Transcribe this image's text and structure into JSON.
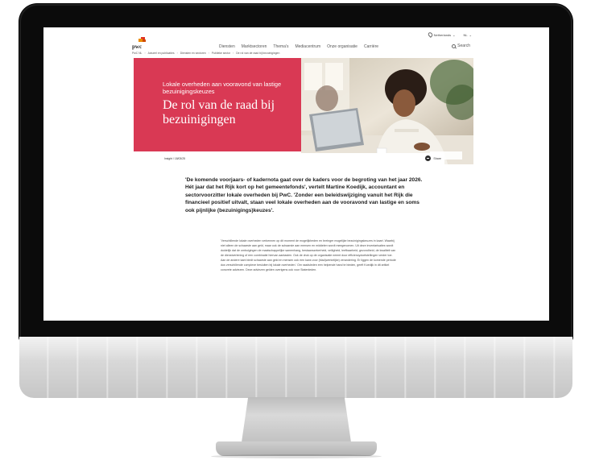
{
  "utility": {
    "country": "Netherlands",
    "language": "NL"
  },
  "brand": {
    "logo_text": "pwc"
  },
  "nav": {
    "items": [
      "Diensten",
      "Marktsectoren",
      "Thema's",
      "Mediacentrum",
      "Onze organisatie",
      "Carrière"
    ],
    "search_label": "Search"
  },
  "breadcrumb": [
    "PwC NL",
    "Actueel en publicaties",
    "Diensten en sectoren",
    "Publieke sector",
    "De rol van de raad bij bezuinigingen"
  ],
  "hero": {
    "subtitle": "Lokale overheden aan vooravond van lastige bezuinigingskeuzes",
    "title": "De rol van de raad bij bezuinigingen",
    "accent_color": "#d93954"
  },
  "article": {
    "meta": "Insight / 18/03/25",
    "share_label": "Share",
    "lead": "'De komende voorjaars- of kadernota gaat over de kaders voor de begroting van het jaar 2026. Hét jaar dat het Rijk kort op het gemeentefonds', vertelt Martine Koedijk, accountant en sectorvoorzitter lokale overheden bij PwC. 'Zonder een beleidswijziging vanuit het Rijk die financieel positief uitvalt, staan veel lokale overheden aan de vooravond van lastige en soms ook pijnlijke (bezuinigings)keuzes'.",
    "body": "'Verschillende lokale overheden verkennen op dit moment de mogelijkheden en breinger mogelijke bezuinigingskeuzes in kaart. Waarbij niet alleen de schaarste aan geld, maar ook de schaarste aan mensen en middelen wordt meegenomen. Uit deze inventarisaties wordt duidelijk dat de ombuigingen de maatschappelijke samenhang, bestaanszekerheid, veiligheid, leefbaarheid, gezondheid, de kwaliteit van de dienstverlening of een combinatie hiervan aantasten. Ook de druk op de organisatie neemt door efficiencydoelstellingen verder toe. Aan de andere kant biedt schaarste aan geld en mensen ook een kans voor (blad)werkelijke) verandering. Er liggen de komende periode dus verschillende complexe besluiten bij lokale overheden.' Om raadsleden een helpende hand te bieden, geeft Koedijk in dit artikel concrete adviezen. Deze adviezen gelden overigens ook voor Statenleden."
  }
}
